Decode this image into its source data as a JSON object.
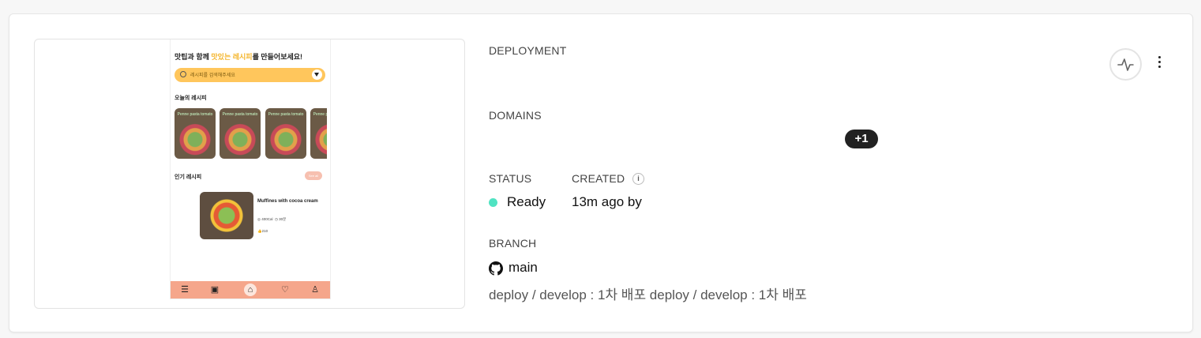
{
  "preview": {
    "app_title_prefix": "맛팁과 함께 ",
    "app_title_highlight": "맛있는 레시피",
    "app_title_suffix": "를 만들어보세요!",
    "search_placeholder": "레시피를 검색해주세요",
    "todays_recipes": "오늘의 레시피",
    "thumb_caption": "Penne pasta tomato",
    "popular_recipes": "인기 레시피",
    "see_all": "See all",
    "popular_item": {
      "title": "Muffines with cocoa cream",
      "calories": "400Cal",
      "time": "30분",
      "likes": "210"
    },
    "bottom_nav": [
      "menu-icon",
      "gallery-icon",
      "home-icon",
      "heart-icon",
      "user-icon"
    ]
  },
  "deployment": {
    "deployment_label": "DEPLOYMENT",
    "domains_label": "DOMAINS",
    "domains_more_badge": "+1",
    "status_label": "STATUS",
    "status_value": "Ready",
    "status_color": "#50e3c2",
    "created_label": "CREATED",
    "info_glyph": "i",
    "created_value": "13m ago by",
    "branch_label": "BRANCH",
    "branch_name": "main",
    "commit_message": "deploy / develop : 1차 배포 deploy / develop : 1차 배포"
  },
  "actions": {
    "activity_icon": "activity-icon",
    "more_icon": "more-vertical-icon"
  }
}
